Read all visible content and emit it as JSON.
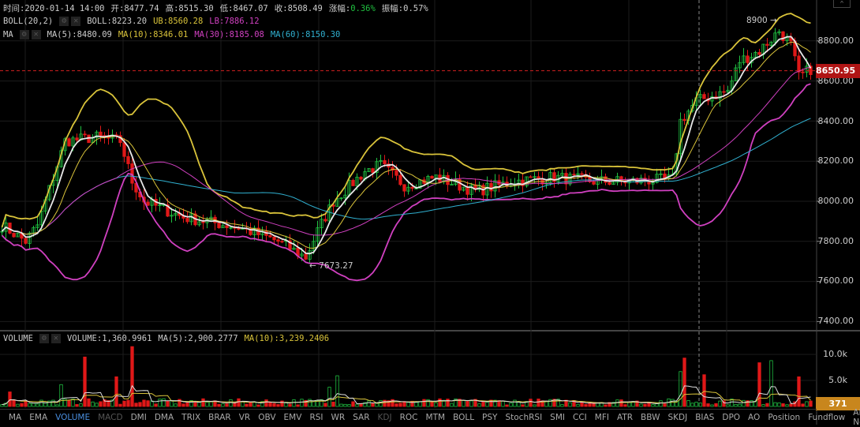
{
  "header": {
    "time_label": "时间:",
    "time": "2020-01-14 14:00",
    "open_label": "开:",
    "open": "8477.74",
    "high_label": "高:",
    "high": "8515.30",
    "low_label": "低:",
    "low": "8467.07",
    "close_label": "收:",
    "close": "8508.49",
    "change_label": "涨幅:",
    "change": "0.36%",
    "amplitude_label": "振幅:",
    "amplitude": "0.57%"
  },
  "boll": {
    "name": "BOLL(20,2)",
    "mid": "BOLL:8223.20",
    "ub": "UB:8560.28",
    "lb": "LB:7886.12"
  },
  "ma": {
    "name": "MA",
    "ma5": "MA(5):8480.09",
    "ma10": "MA(10):8346.01",
    "ma30": "MA(30):8185.08",
    "ma60": "MA(60):8150.30"
  },
  "volume": {
    "name": "VOLUME",
    "value": "VOLUME:1,360.9961",
    "ma5": "MA(5):2,900.2777",
    "ma10": "MA(10):3,239.2406",
    "current": "371"
  },
  "icons": {
    "settings": "⚙",
    "close": "✕",
    "collapse": "^"
  },
  "price_axis": [
    "8800.00",
    "8600.00",
    "8400.00",
    "8200.00",
    "8000.00",
    "7800.00",
    "7600.00",
    "7400.00"
  ],
  "volume_axis": [
    "10.0k",
    "5.0k"
  ],
  "current_price": "8650.95",
  "annotations": {
    "high": "8900 →",
    "low": "← 7673.27"
  },
  "colors": {
    "up": "#20c040",
    "down": "#e01818",
    "boll_ub": "#d9c33a",
    "boll_lb": "#d040c0",
    "ma5": "#e8e8e8",
    "ma10": "#d9c33a",
    "ma30": "#d040c0",
    "ma60": "#30b0d0"
  },
  "chart_data": {
    "type": "candlestick",
    "price_range": [
      7350,
      8950
    ],
    "current_price": 8650.95,
    "close_waypoints": [
      [
        0,
        7880
      ],
      [
        6,
        7800
      ],
      [
        9,
        7880
      ],
      [
        16,
        8300
      ],
      [
        24,
        8320
      ],
      [
        30,
        8300
      ],
      [
        33,
        8100
      ],
      [
        36,
        8000
      ],
      [
        46,
        7920
      ],
      [
        60,
        7870
      ],
      [
        70,
        7800
      ],
      [
        77,
        7720
      ],
      [
        80,
        7850
      ],
      [
        84,
        8000
      ],
      [
        92,
        8150
      ],
      [
        96,
        8180
      ],
      [
        102,
        8080
      ],
      [
        110,
        8120
      ],
      [
        120,
        8050
      ],
      [
        130,
        8100
      ],
      [
        140,
        8120
      ],
      [
        150,
        8100
      ],
      [
        160,
        8100
      ],
      [
        170,
        8110
      ],
      [
        172,
        8400
      ],
      [
        176,
        8500
      ],
      [
        184,
        8550
      ],
      [
        187,
        8700
      ],
      [
        192,
        8750
      ],
      [
        197,
        8850
      ],
      [
        200,
        8780
      ],
      [
        202,
        8620
      ],
      [
        205,
        8660
      ]
    ],
    "volume_spikes": [
      [
        2,
        2800
      ],
      [
        15,
        4200
      ],
      [
        21,
        9500
      ],
      [
        29,
        5700
      ],
      [
        33,
        11500
      ],
      [
        83,
        3700
      ],
      [
        85,
        5900
      ],
      [
        172,
        6700
      ],
      [
        173,
        9300
      ],
      [
        178,
        6100
      ],
      [
        192,
        8400
      ],
      [
        195,
        8800
      ],
      [
        202,
        5700
      ]
    ],
    "volume_range": [
      0,
      11500
    ]
  },
  "tabs": [
    "MA",
    "EMA",
    "VOLUME",
    "MACD",
    "DMI",
    "DMA",
    "TRIX",
    "BRAR",
    "VR",
    "OBV",
    "EMV",
    "RSI",
    "WR",
    "SAR",
    "KDJ",
    "ROC",
    "MTM",
    "BOLL",
    "PSY",
    "StochRSI",
    "SMI",
    "CCI",
    "MFI",
    "ATR",
    "BBW",
    "SKDJ",
    "BIAS",
    "DPO",
    "AO",
    "Position",
    "Fundflow",
    "AI-NetVOL"
  ],
  "active_tab": "VOLUME",
  "disabled_tabs": [
    "MACD",
    "KDJ"
  ]
}
